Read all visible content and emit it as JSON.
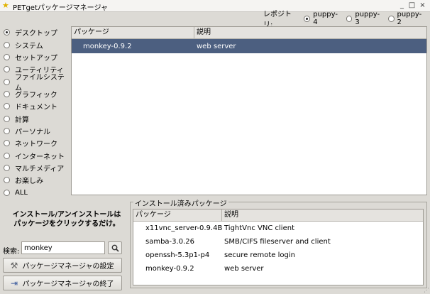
{
  "window": {
    "title": "PETgetパッケージマネージャ",
    "icon": "star-icon",
    "controls": {
      "minimize": "_",
      "maximize": "□",
      "close": "×"
    }
  },
  "repository": {
    "label": "レポジトリ:",
    "options": [
      {
        "label": "puppy-4",
        "selected": true
      },
      {
        "label": "puppy-3",
        "selected": false
      },
      {
        "label": "puppy-2",
        "selected": false
      }
    ]
  },
  "categories": [
    {
      "label": "デスクトップ",
      "selected": true
    },
    {
      "label": "システム",
      "selected": false
    },
    {
      "label": "セットアップ",
      "selected": false
    },
    {
      "label": "ユーティリティ",
      "selected": false
    },
    {
      "label": "ファイルシステム",
      "selected": false
    },
    {
      "label": "グラフィック",
      "selected": false
    },
    {
      "label": "ドキュメント",
      "selected": false
    },
    {
      "label": "計算",
      "selected": false
    },
    {
      "label": "パーソナル",
      "selected": false
    },
    {
      "label": "ネットワーク",
      "selected": false
    },
    {
      "label": "インターネット",
      "selected": false
    },
    {
      "label": "マルチメディア",
      "selected": false
    },
    {
      "label": "お楽しみ",
      "selected": false
    },
    {
      "label": "ALL",
      "selected": false
    }
  ],
  "available": {
    "columns": [
      "パッケージ",
      "説明"
    ],
    "rows": [
      {
        "package": "monkey-0.9.2",
        "description": "web server",
        "selected": true
      }
    ],
    "selection_color": "#4c5f80"
  },
  "instructions": {
    "line1": "インストール/アンインストールは",
    "line2": "パッケージをクリックするだけ。"
  },
  "search": {
    "label": "検索:",
    "value": "monkey",
    "button_icon": "search-icon"
  },
  "buttons": {
    "settings": {
      "label": "パッケージマネージャの設定",
      "icon": "wrench-icon"
    },
    "quit": {
      "label": "パッケージマネージャの終了",
      "icon": "exit-icon"
    }
  },
  "installed": {
    "title": "インストール済みパッケージ",
    "columns": [
      "パッケージ",
      "説明"
    ],
    "rows": [
      {
        "package": "x11vnc_server-0.9.4B",
        "description": "TightVnc VNC client"
      },
      {
        "package": "samba-3.0.26",
        "description": "SMB/CIFS fileserver and client"
      },
      {
        "package": "openssh-5.3p1-p4",
        "description": "secure remote login"
      },
      {
        "package": "monkey-0.9.2",
        "description": "web server"
      }
    ]
  }
}
